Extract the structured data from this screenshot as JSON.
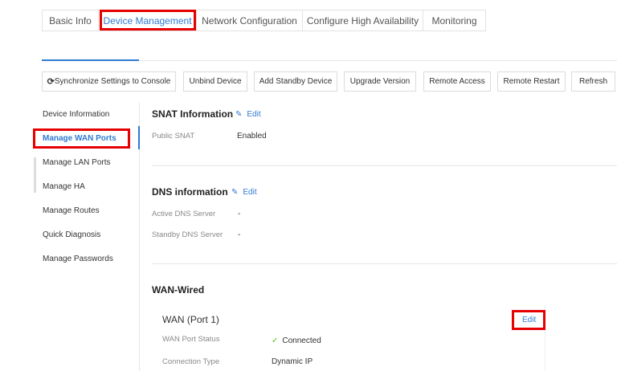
{
  "tabs": [
    {
      "label": "Basic Info"
    },
    {
      "label": "Device Management"
    },
    {
      "label": "Network Configuration"
    },
    {
      "label": "Configure High Availability"
    },
    {
      "label": "Monitoring"
    }
  ],
  "toolbar": {
    "sync": "Synchronize Settings to Console",
    "unbind": "Unbind Device",
    "add_standby": "Add Standby Device",
    "upgrade": "Upgrade Version",
    "remote_access": "Remote Access",
    "remote_restart": "Remote Restart",
    "refresh": "Refresh"
  },
  "sidebar": {
    "items": [
      {
        "label": "Device Information"
      },
      {
        "label": "Manage WAN Ports"
      },
      {
        "label": "Manage LAN Ports"
      },
      {
        "label": "Manage HA"
      },
      {
        "label": "Manage Routes"
      },
      {
        "label": "Quick Diagnosis"
      },
      {
        "label": "Manage Passwords"
      }
    ]
  },
  "snat": {
    "title": "SNAT Information",
    "edit": "Edit",
    "public_snat_label": "Public SNAT",
    "public_snat_value": "Enabled"
  },
  "dns": {
    "title": "DNS information",
    "edit": "Edit",
    "active_label": "Active DNS Server",
    "active_value": "-",
    "standby_label": "Standby DNS Server",
    "standby_value": "-"
  },
  "wan": {
    "title": "WAN-Wired",
    "port_title": "WAN (Port 1)",
    "edit": "Edit",
    "status_label": "WAN Port Status",
    "status_value": "Connected",
    "conn_type_label": "Connection Type",
    "conn_type_value": "Dynamic IP"
  },
  "colors": {
    "accent": "#2f7ad1",
    "highlight": "#e60000",
    "success": "#52c41a"
  }
}
